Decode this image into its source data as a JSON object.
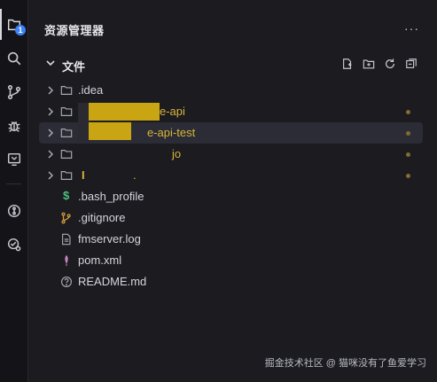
{
  "panel": {
    "title": "资源管理器",
    "more_label": "···"
  },
  "section": {
    "title": "文件"
  },
  "tree": [
    {
      "label": ".idea",
      "type": "folder",
      "modified": false,
      "selected": false
    },
    {
      "label": "e-api",
      "type": "folder",
      "modified": true,
      "selected": false
    },
    {
      "label": "e-api-test",
      "type": "folder",
      "modified": true,
      "selected": true
    },
    {
      "label": "jo",
      "type": "folder",
      "modified": true,
      "selected": false
    },
    {
      "label": ".",
      "type": "folder",
      "modified": true,
      "selected": false
    },
    {
      "label": ".bash_profile",
      "type": "file",
      "icon": "dollar-icon",
      "modified": false,
      "selected": false
    },
    {
      "label": ".gitignore",
      "type": "file",
      "icon": "git-icon",
      "modified": false,
      "selected": false
    },
    {
      "label": "fmserver.log",
      "type": "file",
      "icon": "log-file-icon",
      "modified": false,
      "selected": false
    },
    {
      "label": "pom.xml",
      "type": "file",
      "icon": "feather-icon",
      "modified": false,
      "selected": false
    },
    {
      "label": "README.md",
      "type": "file",
      "icon": "question-icon",
      "modified": false,
      "selected": false
    }
  ],
  "activity": {
    "badge": "1"
  },
  "watermark": "掘金技术社区 @ 猫咪没有了鱼爱学习",
  "colors": {
    "accent": "#3b82f6",
    "modified": "#d8b53a",
    "background": "#1b1b20"
  }
}
